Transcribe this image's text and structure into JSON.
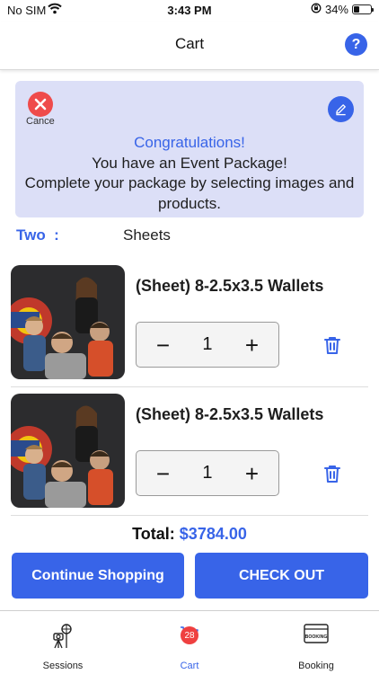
{
  "status_bar": {
    "carrier": "No SIM",
    "time": "3:43 PM",
    "battery": "34%",
    "battery_level": 0.34
  },
  "nav": {
    "title": "Cart",
    "help_icon": "?"
  },
  "banner": {
    "cancel_label": "Cance",
    "congrats": "Congratulations!",
    "line1": "You have an Event Package!",
    "line2": "Complete your package by selecting images and products."
  },
  "package": {
    "label": "Two  :",
    "value": "Sheets"
  },
  "items": [
    {
      "title": "(Sheet) 8-2.5x3.5 Wallets",
      "quantity": "1",
      "minus": "−",
      "plus": "+"
    },
    {
      "title": "(Sheet) 8-2.5x3.5 Wallets",
      "quantity": "1",
      "minus": "−",
      "plus": "+"
    }
  ],
  "total": {
    "label": "Total:",
    "amount": "$3784.00"
  },
  "actions": {
    "continue_label": "Continue Shopping",
    "checkout_label": "CHECK OUT"
  },
  "tabs": [
    {
      "label": "Sessions",
      "icon": "camera-tripod-icon"
    },
    {
      "label": "Cart",
      "icon": "cart-icon",
      "badge": "28"
    },
    {
      "label": "Booking",
      "icon": "booking-icon",
      "icon_text": "BOOKING"
    }
  ],
  "colors": {
    "accent": "#3864e8",
    "cancel": "#ef4b4b",
    "banner_bg": "#dcdff7",
    "badge": "#ef4040"
  }
}
